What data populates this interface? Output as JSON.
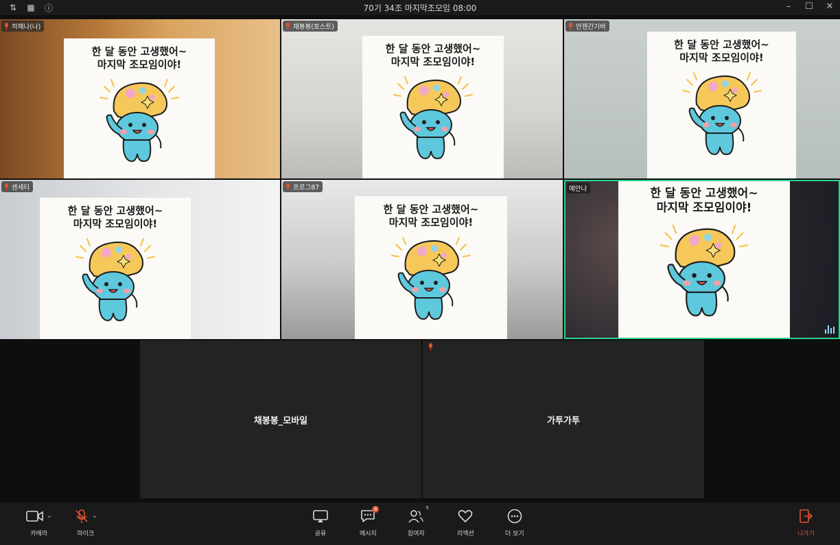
{
  "window": {
    "title": "70기 34조 마지막조모임 08:00",
    "left_icons": [
      "sort-icon",
      "grid-view-icon",
      "info-icon"
    ],
    "controls": [
      "minimize-icon",
      "maximize-icon",
      "close-icon"
    ]
  },
  "card": {
    "line1": "한 달 동안 고생했어~",
    "line2": "마지막 조모임이야!"
  },
  "participants": [
    {
      "name": "히헤나(나)",
      "mic": "off"
    },
    {
      "name": "채봉봉(호스트)",
      "mic": "off"
    },
    {
      "name": "안젠간기버",
      "mic": "off"
    },
    {
      "name": "센세티",
      "mic": "off"
    },
    {
      "name": "프로그87",
      "mic": "off"
    },
    {
      "name": "예안나",
      "mic": "on",
      "active_speaker": true
    }
  ],
  "audio_only": [
    {
      "name": "채봉봉_모바일"
    },
    {
      "name": "가투가투"
    }
  ],
  "toolbar": {
    "camera": "카메라",
    "mic": "마이크",
    "share": "공유",
    "messages": "메시지",
    "messages_badge": "8",
    "participants": "참여자",
    "participants_count": "9",
    "reactions": "리액션",
    "more": "더 보기",
    "leave": "나가기"
  },
  "colors": {
    "accent": "#e0522e",
    "active_speaker_border": "#2ed28c",
    "mascot_body": "#5ec8dc",
    "mascot_hat": "#f6c85a"
  }
}
